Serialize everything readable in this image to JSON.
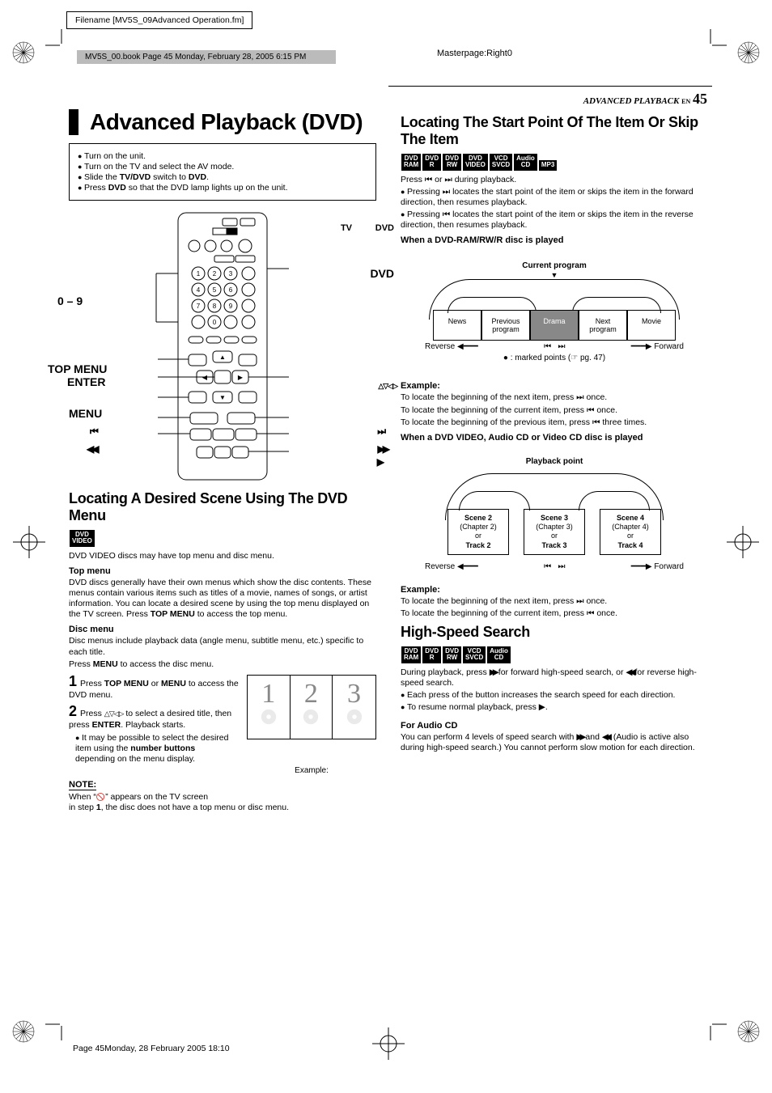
{
  "meta": {
    "filename": "Filename [MV5S_09Advanced Operation.fm]",
    "book_bar": "MV5S_00.book  Page 45  Monday, February 28, 2005  6:15 PM",
    "masterpage": "Masterpage:Right0",
    "header_section": "ADVANCED PLAYBACK",
    "header_en": "EN",
    "header_page": "45",
    "footer": "Page 45Monday, 28 February 2005  18:10"
  },
  "left": {
    "title": "Advanced Playback (DVD)",
    "setup": [
      "Turn on the unit.",
      "Turn on the TV and select the AV mode.",
      "Slide the TV/DVD switch to DVD.",
      "Press DVD so that the DVD lamp lights up on the unit."
    ],
    "setup_html": [
      "Turn on the unit.",
      "Turn on the TV and select the AV mode.",
      "Slide the <b>TV/DVD</b> switch to <b>DVD</b>.",
      "Press <b>DVD</b> so that the DVD lamp lights up on the unit."
    ],
    "remote_labels": {
      "tv": "TV",
      "dvd_switch": "DVD",
      "dvd_top": "DVD",
      "zero_nine": "0 – 9",
      "top_menu": "TOP MENU",
      "enter": "ENTER",
      "menu": "MENU"
    },
    "sect1": "Locating A Desired Scene Using The DVD Menu",
    "sect1_badge": {
      "l1": "DVD",
      "l2": "VIDEO"
    },
    "sect1_p1": "DVD VIDEO discs may have top menu and disc menu.",
    "sect1_h_topmenu": "Top menu",
    "sect1_p2": "DVD discs generally have their own menus which show the disc contents. These menus contain various items such as titles of a movie, names of songs, or artist information. You can locate a desired scene by using the top menu displayed on the TV screen. Press TOP MENU to access the top menu.",
    "sect1_h_discmenu": "Disc menu",
    "sect1_p3": "Disc menus include playback data (angle menu, subtitle menu, etc.) specific to each title.",
    "sect1_p4": "Press MENU to access the disc menu.",
    "step1": "Press TOP MENU or MENU to access the DVD menu.",
    "step2": "Press △▽◁▷ to select a desired title, then press ENTER. Playback starts.",
    "step2_bullet": "It may be possible to select the desired item using the number buttons depending on the menu display.",
    "example_label": "Example:",
    "note_h": "NOTE:",
    "note_p1": "When \"⊘\" appears on the TV screen",
    "note_p2": "in step 1, the disc does not have a top menu or disc menu."
  },
  "right": {
    "sect2": "Locating The Start Point Of The Item Or Skip The Item",
    "badges2": [
      {
        "l1": "DVD",
        "l2": "RAM"
      },
      {
        "l1": "DVD",
        "l2": "R"
      },
      {
        "l1": "DVD",
        "l2": "RW"
      },
      {
        "l1": "DVD",
        "l2": "VIDEO"
      },
      {
        "l1": "VCD",
        "l2": "SVCD"
      },
      {
        "l1": "Audio",
        "l2": "CD"
      },
      {
        "l1": "MP3",
        "l2": ""
      }
    ],
    "sect2_p0": "Press ⏮ or ⏭ during playback.",
    "sect2_b1": "Pressing ⏭ locates the start point of the item or skips the item in the forward direction, then resumes playback.",
    "sect2_b2": "Pressing ⏮ locates the start point of the item or skips the item in the reverse direction, then resumes playback.",
    "when_ram": "When a DVD-RAM/RW/R disc is played",
    "diagram1": {
      "current": "Current program",
      "boxes": [
        "News",
        "Previous program",
        "Drama",
        "Next program",
        "Movie"
      ],
      "reverse": "Reverse",
      "forward": "Forward",
      "marked": "● : marked points (☞ pg. 47)"
    },
    "ex1_h": "Example:",
    "ex1_l1": "To locate the beginning of the next item, press ⏭ once.",
    "ex1_l2": "To locate the beginning of the current item, press ⏮ once.",
    "ex1_l3": "To locate the beginning of the previous item, press ⏮ three times.",
    "when_video": "When a DVD VIDEO, Audio CD or Video CD disc is played",
    "diagram2": {
      "point": "Playback point",
      "boxes": [
        {
          "t": "Scene 2",
          "c": "(Chapter 2)",
          "o": "or",
          "k": "Track 2"
        },
        {
          "t": "Scene 3",
          "c": "(Chapter 3)",
          "o": "or",
          "k": "Track 3"
        },
        {
          "t": "Scene 4",
          "c": "(Chapter 4)",
          "o": "or",
          "k": "Track 4"
        }
      ],
      "reverse": "Reverse",
      "forward": "Forward"
    },
    "ex2_h": "Example:",
    "ex2_l1": "To locate the beginning of the next item, press ⏭ once.",
    "ex2_l2": "To locate the beginning of the current item, press ⏮ once.",
    "sect3": "High-Speed Search",
    "badges3": [
      {
        "l1": "DVD",
        "l2": "RAM"
      },
      {
        "l1": "DVD",
        "l2": "R"
      },
      {
        "l1": "DVD",
        "l2": "RW"
      },
      {
        "l1": "VCD",
        "l2": "SVCD"
      },
      {
        "l1": "Audio",
        "l2": "CD"
      }
    ],
    "sect3_p1": "During playback, press ▶▶ for forward high-speed search, or ◀◀ for reverse high-speed search.",
    "sect3_b1": "Each press of the button increases the search speed for each direction.",
    "sect3_b2": "To resume normal playback, press ▶.",
    "sect3_h_audio": "For Audio CD",
    "sect3_p_audio": "You can perform 4 levels of speed search with ▶▶ and ◀◀. (Audio is active also during high-speed search.) You cannot perform slow motion for each direction."
  }
}
